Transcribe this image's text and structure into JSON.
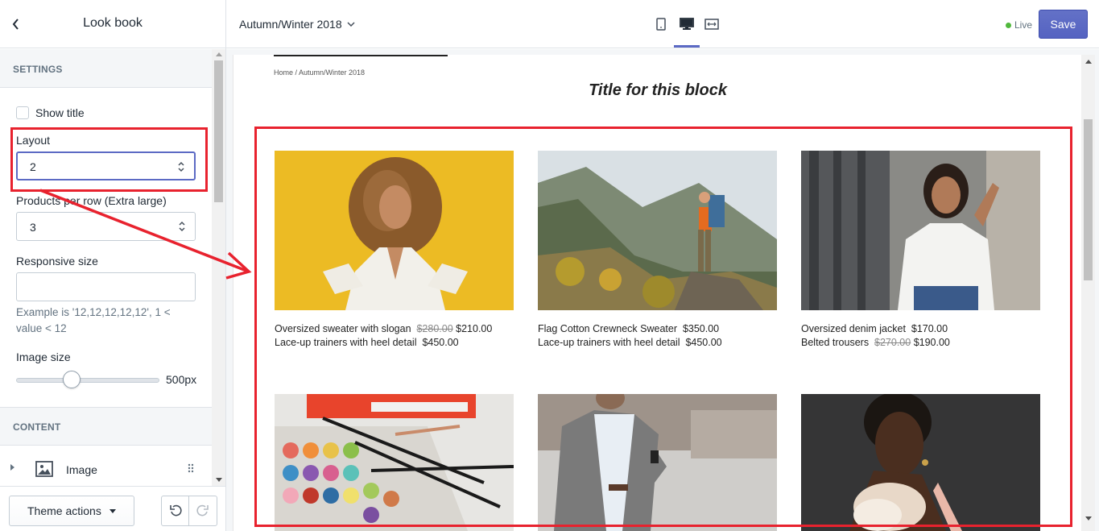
{
  "sidebar": {
    "title": "Look book",
    "settings_heading": "SETTINGS",
    "show_title_label": "Show title",
    "layout": {
      "label": "Layout",
      "value": "2"
    },
    "products_per_row": {
      "label": "Products per row (Extra large)",
      "value": "3"
    },
    "responsive_size": {
      "label": "Responsive size",
      "value": "",
      "help": "Example is '12,12,12,12,12', 1 < value < 12"
    },
    "image_size": {
      "label": "Image size",
      "value": "500px"
    },
    "content_heading": "CONTENT",
    "content_items": [
      {
        "label": "Image"
      }
    ],
    "theme_actions_label": "Theme actions"
  },
  "topbar": {
    "template": "Autumn/Winter 2018",
    "status": "Live",
    "save_label": "Save"
  },
  "preview": {
    "breadcrumb": "Home  /  Autumn/Winter 2018",
    "title": "Title for this block",
    "looks": [
      {
        "lines": [
          {
            "name": "Oversized sweater with slogan",
            "old_price": "$280.00",
            "price": "$210.00"
          },
          {
            "name": "Lace-up trainers with heel detail",
            "old_price": "",
            "price": "$450.00"
          }
        ]
      },
      {
        "lines": [
          {
            "name": "Flag Cotton Crewneck Sweater",
            "old_price": "",
            "price": "$350.00"
          },
          {
            "name": "Lace-up trainers with heel detail",
            "old_price": "",
            "price": "$450.00"
          }
        ]
      },
      {
        "lines": [
          {
            "name": "Oversized denim jacket",
            "old_price": "",
            "price": "$170.00"
          },
          {
            "name": "Belted trousers",
            "old_price": "$270.00",
            "price": "$190.00"
          }
        ]
      }
    ]
  },
  "colors": {
    "accent": "#5c6ac4",
    "live": "#50b83c",
    "annotation": "#e8222e"
  }
}
